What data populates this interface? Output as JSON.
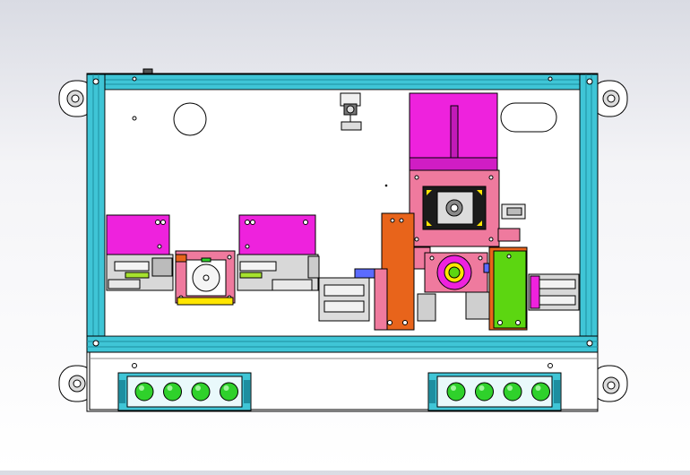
{
  "viewport": {
    "background": "gradient-grey-white"
  },
  "colors": {
    "frame": "#3fc5d6",
    "frame_dark": "#1d8ea0",
    "magenta": "#ee22dd",
    "pink": "#ef7a9e",
    "orange": "#e8641b",
    "green": "#5cd611",
    "button_green": "#2fd12b",
    "yellow": "#ffe600",
    "grey": "#d0d0d0",
    "panel": "#ffffff"
  },
  "components": {
    "enclosure": "aluminum-profile-frame",
    "mounting_tabs": 4,
    "button_strips": [
      {
        "name": "left-button-strip",
        "buttons": 4
      },
      {
        "name": "right-button-strip",
        "buttons": 4
      }
    ],
    "slide_modules": 2,
    "cameras": 1,
    "icons": [
      "knob-icon",
      "bolt-icon",
      "button-icon",
      "motor-icon"
    ]
  }
}
